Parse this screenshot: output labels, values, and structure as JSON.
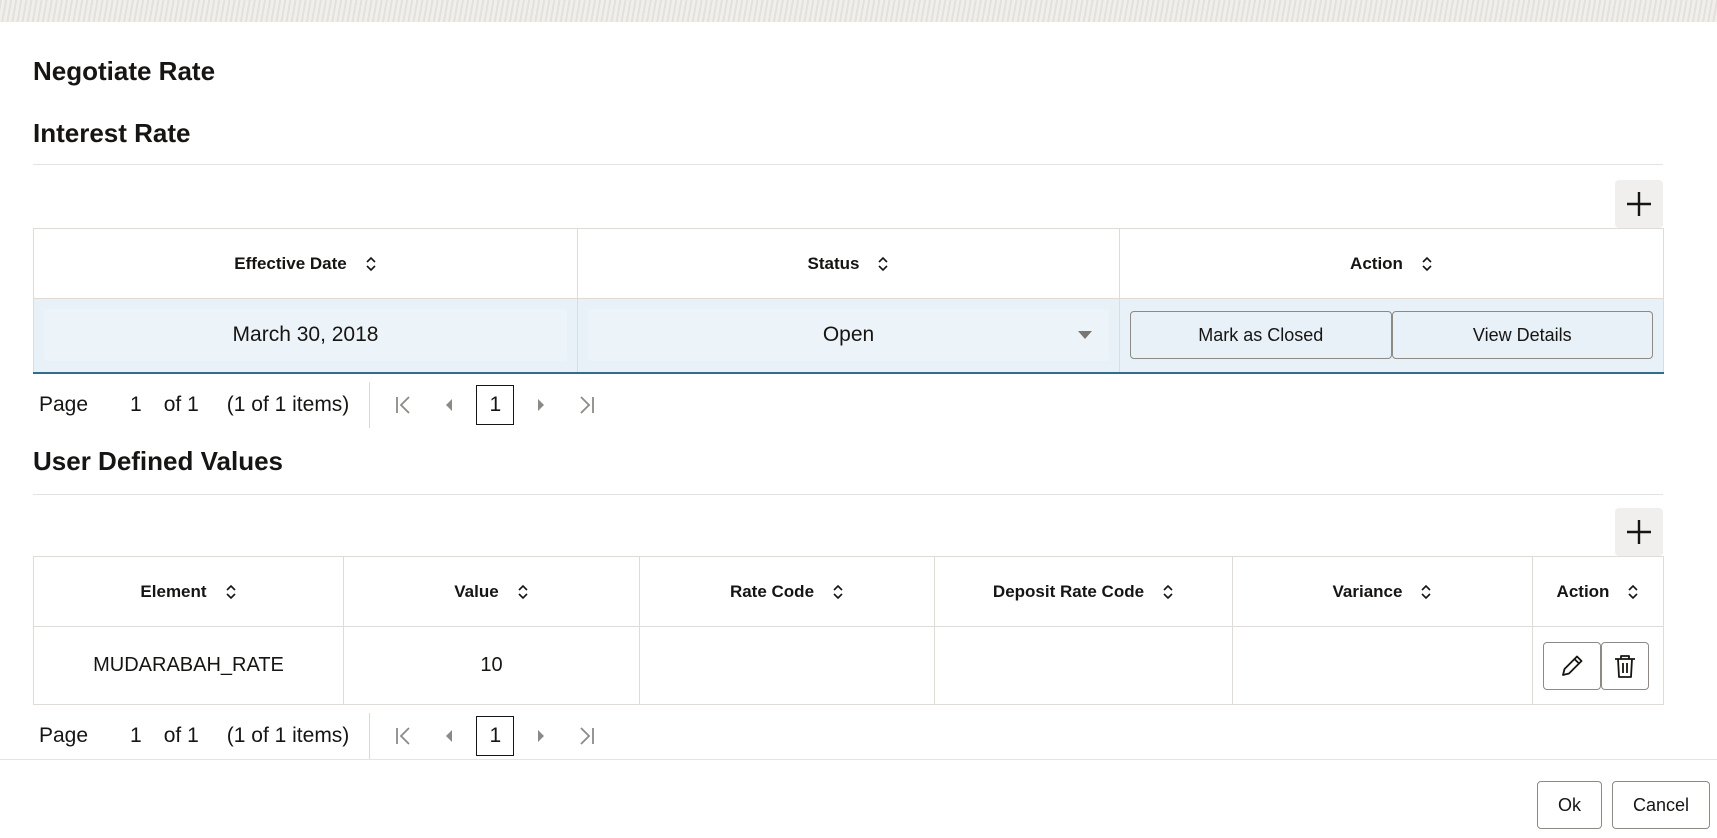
{
  "dialog": {
    "title": "Negotiate Rate"
  },
  "interest_rate": {
    "title": "Interest Rate",
    "columns": [
      "Effective Date",
      "Status",
      "Action"
    ],
    "row": {
      "effective_date": "March 30, 2018",
      "status": "Open",
      "mark_closed_label": "Mark as Closed",
      "view_details_label": "View Details"
    },
    "pager": {
      "page_label": "Page",
      "current": "1",
      "of_label": "of 1",
      "items_label": "(1 of 1 items)",
      "page_box": "1"
    }
  },
  "user_defined_values": {
    "title": "User Defined Values",
    "columns": [
      "Element",
      "Value",
      "Rate Code",
      "Deposit Rate Code",
      "Variance",
      "Action"
    ],
    "row": {
      "element": "MUDARABAH_RATE",
      "value": "10",
      "rate_code": "",
      "deposit_rate_code": "",
      "variance": ""
    },
    "pager": {
      "page_label": "Page",
      "current": "1",
      "of_label": "of 1",
      "items_label": "(1 of 1 items)",
      "page_box": "1"
    }
  },
  "footer": {
    "ok_label": "Ok",
    "cancel_label": "Cancel"
  },
  "icons": {
    "add": "plus-icon",
    "sort": "sort-icon",
    "caret": "chevron-down-icon",
    "first": "first-page-icon",
    "prev": "previous-page-icon",
    "next": "next-page-icon",
    "last": "last-page-icon",
    "edit": "pencil-icon",
    "delete": "trash-icon"
  },
  "colors": {
    "selected_row": "#e8f1f7",
    "selected_border": "#2d6e8e",
    "text": "#161513"
  }
}
